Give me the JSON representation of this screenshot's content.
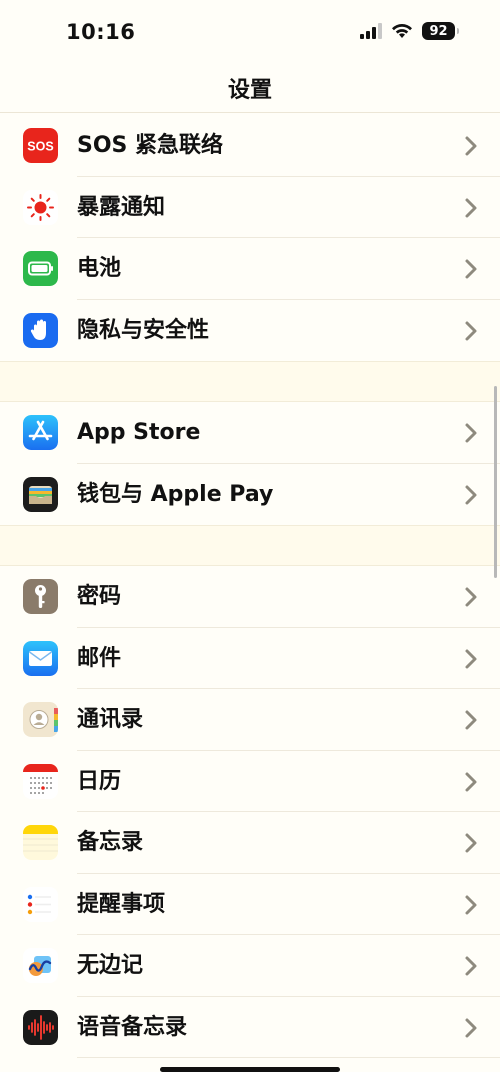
{
  "status_bar": {
    "time": "10:16",
    "battery": "92"
  },
  "nav": {
    "title": "设置"
  },
  "groups": [
    {
      "items": [
        {
          "label": "SOS 紧急联络",
          "icon": "sos-icon",
          "color": "#e8251c",
          "icon_text": "SOS"
        },
        {
          "label": "暴露通知",
          "icon": "exposure-notification-icon",
          "color": "#ffffff"
        },
        {
          "label": "电池",
          "icon": "battery-icon",
          "color": "#2db84b"
        },
        {
          "label": "隐私与安全性",
          "icon": "privacy-hand-icon",
          "color": "#1a6bf0"
        }
      ]
    },
    {
      "items": [
        {
          "label": "App Store",
          "icon": "app-store-icon",
          "color": "#1c8cf5"
        },
        {
          "label": "钱包与 Apple Pay",
          "icon": "wallet-icon",
          "color": "#1c1c1c"
        }
      ]
    },
    {
      "items": [
        {
          "label": "密码",
          "icon": "key-icon",
          "color": "#8a7b6a"
        },
        {
          "label": "邮件",
          "icon": "mail-icon",
          "color": "#2b8cf2"
        },
        {
          "label": "通讯录",
          "icon": "contacts-icon",
          "color": "#f1e6cf"
        },
        {
          "label": "日历",
          "icon": "calendar-icon",
          "color": "#ffffff"
        },
        {
          "label": "备忘录",
          "icon": "notes-icon",
          "color": "#fff7c2"
        },
        {
          "label": "提醒事项",
          "icon": "reminders-icon",
          "color": "#ffffff"
        },
        {
          "label": "无边记",
          "icon": "freeform-icon",
          "color": "#ffffff"
        },
        {
          "label": "语音备忘录",
          "icon": "voice-memos-icon",
          "color": "#1a1a1a"
        }
      ]
    }
  ]
}
